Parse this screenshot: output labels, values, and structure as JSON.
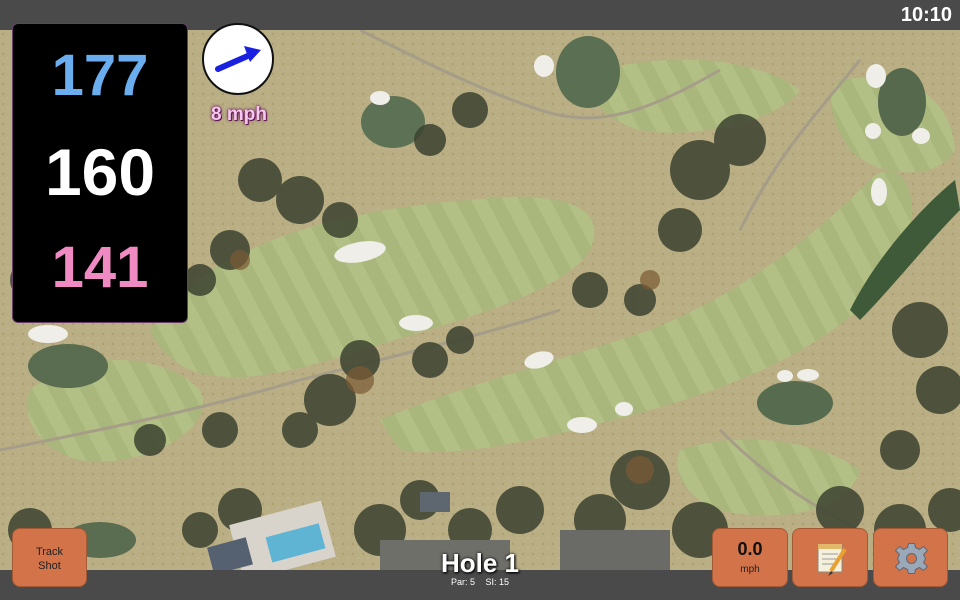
{
  "status": {
    "time": "10:10"
  },
  "distances": {
    "back": "177",
    "middle": "160",
    "front": "141"
  },
  "wind": {
    "speed_label": "8 mph",
    "direction_icon": "wind-arrow-icon"
  },
  "buttons": {
    "track_shot": {
      "line1": "Track",
      "line2": "Shot"
    },
    "speed": {
      "value": "0.0",
      "unit": "mph"
    },
    "notes_icon": "notepad-icon",
    "settings_icon": "gear-icon"
  },
  "hole": {
    "title": "Hole 1",
    "par_label": "Par: 5",
    "si_label": "SI: 15"
  },
  "colors": {
    "back_distance": "#6aaef0",
    "middle_distance": "#ffffff",
    "front_distance": "#f08ac2",
    "button_bg": "#d2734a",
    "bar_bg": "#4a4a4a"
  }
}
